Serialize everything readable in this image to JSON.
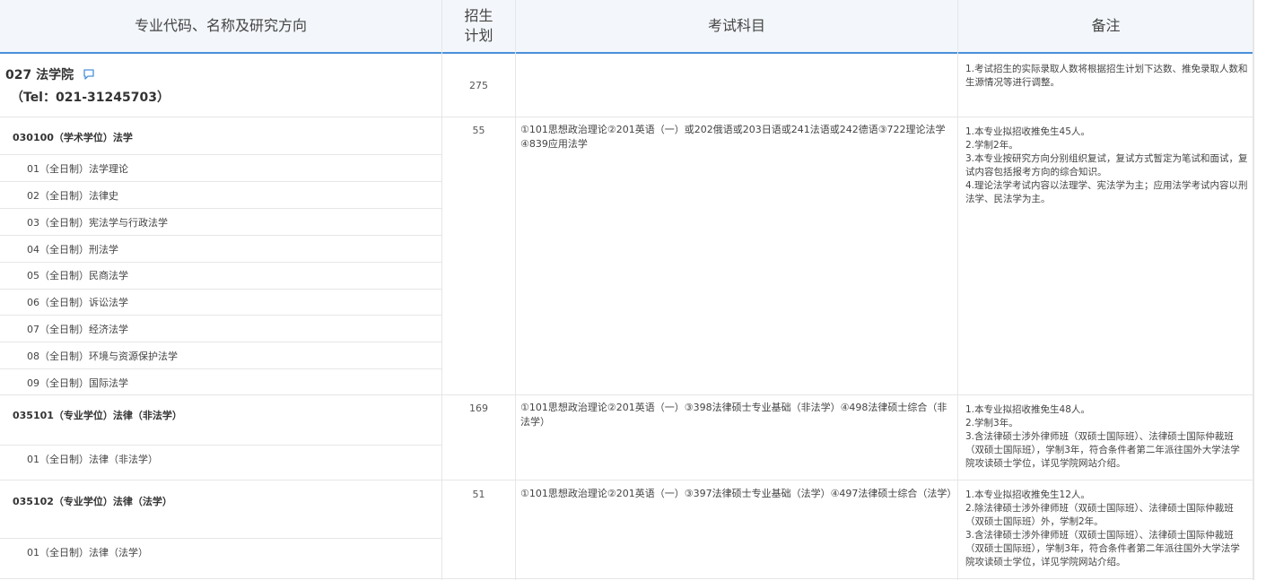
{
  "headers": {
    "col1": "专业代码、名称及研究方向",
    "col2a": "招生",
    "col2b": "计划",
    "col3": "考试科目",
    "col4": "备注"
  },
  "department": {
    "name": "027 法学院",
    "tel": "（Tel：021-31245703）",
    "plan": "275",
    "note": "1.考试招生的实际录取人数将根据招生计划下达数、推免录取人数和生源情况等进行调整。",
    "icon": "comment-icon"
  },
  "majors": [
    {
      "title": "030100（学术学位）法学",
      "plan": "55",
      "exam": "①101思想政治理论②201英语（一）或202俄语或203日语或241法语或242德语③722理论法学④839应用法学",
      "note": "1.本专业拟招收推免生45人。\n2.学制2年。\n3.本专业按研究方向分别组织复试，复试方式暂定为笔试和面试，复试内容包括报考方向的综合知识。\n4.理论法学考试内容以法理学、宪法学为主；应用法学考试内容以刑法学、民法学为主。",
      "directions": [
        "01（全日制）法学理论",
        "02（全日制）法律史",
        "03（全日制）宪法学与行政法学",
        "04（全日制）刑法学",
        "05（全日制）民商法学",
        "06（全日制）诉讼法学",
        "07（全日制）经济法学",
        "08（全日制）环境与资源保护法学",
        "09（全日制）国际法学"
      ]
    },
    {
      "title": "035101（专业学位）法律（非法学）",
      "plan": "169",
      "exam": "①101思想政治理论②201英语（一）③398法律硕士专业基础（非法学）④498法律硕士综合（非法学）",
      "note": "1.本专业拟招收推免生48人。\n2.学制3年。\n3.含法律硕士涉外律师班（双硕士国际班）、法律硕士国际仲裁班（双硕士国际班），学制3年，符合条件者第二年派往国外大学法学院攻读硕士学位，详见学院网站介绍。",
      "directions": [
        "01（全日制）法律（非法学）"
      ]
    },
    {
      "title": "035102（专业学位）法律（法学）",
      "plan": "51",
      "exam": "①101思想政治理论②201英语（一）③397法律硕士专业基础（法学）④497法律硕士综合（法学）",
      "note": "1.本专业拟招收推免生12人。\n2.除法律硕士涉外律师班（双硕士国际班）、法律硕士国际仲裁班（双硕士国际班）外，学制2年。\n3.含法律硕士涉外律师班（双硕士国际班）、法律硕士国际仲裁班（双硕士国际班），学制3年，符合条件者第二年派往国外大学法学院攻读硕士学位，详见学院网站介绍。",
      "directions": [
        "01（全日制）法律（法学）"
      ]
    }
  ],
  "colors": {
    "accent": "#4a90d9",
    "header_bg": "#f3f7fb",
    "border": "#e6e6e6"
  }
}
